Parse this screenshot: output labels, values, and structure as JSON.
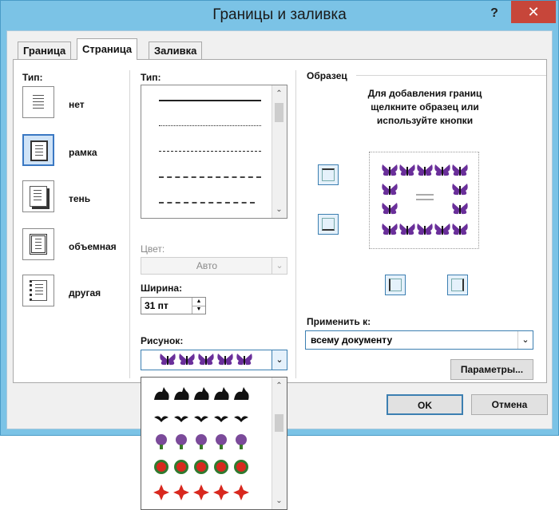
{
  "window": {
    "title": "Границы и заливка",
    "help": "?",
    "close": "✕"
  },
  "tabs": [
    {
      "label": "Граница",
      "active": false
    },
    {
      "label": "Страница",
      "active": true
    },
    {
      "label": "Заливка",
      "active": false
    }
  ],
  "setting": {
    "label": "Тип:",
    "items": [
      {
        "label": "нет",
        "selected": false
      },
      {
        "label": "рамка",
        "selected": true
      },
      {
        "label": "тень",
        "selected": false
      },
      {
        "label": "объемная",
        "selected": false
      },
      {
        "label": "другая",
        "selected": false
      }
    ]
  },
  "style": {
    "label": "Тип:",
    "lines": [
      "solid",
      "dotted",
      "dashed",
      "long-dashed",
      "dash-dot"
    ]
  },
  "color": {
    "label": "Цвет:",
    "value": "Авто"
  },
  "width": {
    "label": "Ширина:",
    "value": "31 пт"
  },
  "art": {
    "label": "Рисунок:",
    "selected_icon": "purple-butterfly",
    "options": [
      "black-cat",
      "black-bat",
      "purple-flower",
      "red-flower",
      "red-poinsettia"
    ]
  },
  "preview": {
    "label": "Образец",
    "hint_line1": "Для добавления границ",
    "hint_line2": "щелкните образец или",
    "hint_line3": "используйте кнопки"
  },
  "apply": {
    "label": "Применить к:",
    "value": "всему документу"
  },
  "buttons": {
    "options": "Параметры...",
    "ok": "OK",
    "cancel": "Отмена"
  },
  "colors": {
    "accent": "#3c7fb1",
    "title_bar": "#7bc3e6",
    "close": "#c7463a",
    "butterfly": "#6a2f9a"
  }
}
